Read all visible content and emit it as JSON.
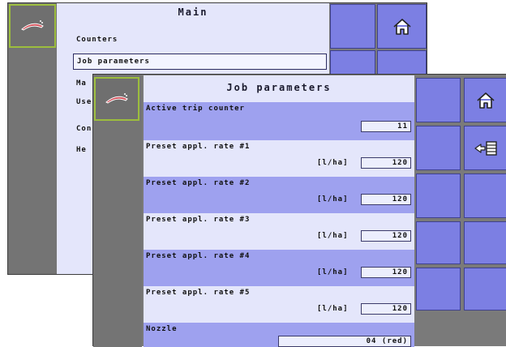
{
  "main_screen": {
    "title": "Main",
    "menu": [
      {
        "label": "Counters",
        "selected": false
      },
      {
        "label": "Job parameters",
        "selected": true
      },
      {
        "label": "Ma",
        "selected": false
      },
      {
        "label": "Use",
        "selected": false
      },
      {
        "label": "Con",
        "selected": false
      },
      {
        "label": "He",
        "selected": false
      }
    ],
    "side_buttons": [
      "home-icon",
      "back-list-icon"
    ]
  },
  "job_screen": {
    "title": "Job parameters",
    "rows": [
      {
        "label": "Active trip counter",
        "unit": "",
        "value": "11"
      },
      {
        "label": "Preset appl. rate #1",
        "unit": "[l/ha]",
        "value": "120"
      },
      {
        "label": "Preset appl. rate #2",
        "unit": "[l/ha]",
        "value": "120"
      },
      {
        "label": "Preset appl. rate #3",
        "unit": "[l/ha]",
        "value": "120"
      },
      {
        "label": "Preset appl. rate #4",
        "unit": "[l/ha]",
        "value": "120"
      },
      {
        "label": "Preset appl. rate #5",
        "unit": "[l/ha]",
        "value": "120"
      },
      {
        "label": "Nozzle",
        "unit": "",
        "value": "04 (red)"
      }
    ],
    "side_buttons": [
      "home-icon",
      "back-list-icon",
      "empty",
      "empty",
      "empty",
      "empty"
    ]
  },
  "colors": {
    "content_bg": "#e4e6fb",
    "row_highlight": "#9ea1ef",
    "button": "#7c7fe3",
    "frame": "#7a7a7a",
    "logo_border": "#9cbd3d"
  }
}
